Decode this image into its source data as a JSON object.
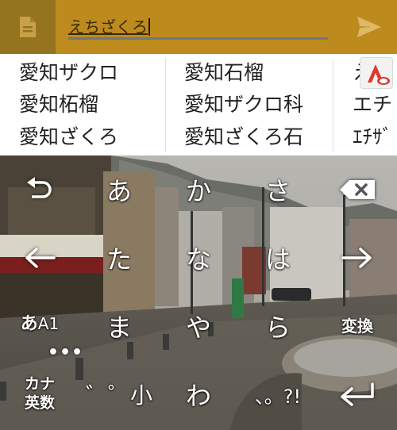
{
  "input": {
    "text": "えちざくろ"
  },
  "candidates": {
    "col1": [
      "愛知ザクロ",
      "愛知柘榴",
      "愛知ざくろ"
    ],
    "col2": [
      "愛知石榴",
      "愛知ザクロ科",
      "愛知ざくろ石"
    ],
    "col3": [
      "え",
      "エチ",
      "ｴﾁｻﾞ"
    ]
  },
  "keyboard": {
    "row1": [
      "undo-icon",
      "あ",
      "か",
      "さ",
      "backspace-icon"
    ],
    "row2": [
      "arrow-left-icon",
      "た",
      "な",
      "は",
      "arrow-right-icon"
    ],
    "row3": {
      "mode_main": "あ",
      "mode_sub": "A1",
      "mode_dots": "•••",
      "keys": [
        "ま",
        "や",
        "ら"
      ],
      "convert": "変換"
    },
    "row4": {
      "kana_label": "カナ",
      "eisu_label": "英数",
      "dakuten": "゛゜小",
      "wa": "わ",
      "punct": "、。?!"
    }
  },
  "colors": {
    "topbar": "#8a6a1c",
    "input_bg": "#bd8a1d",
    "candidate_bg": "#ffffff",
    "cloud_icon": "#e0392b"
  }
}
